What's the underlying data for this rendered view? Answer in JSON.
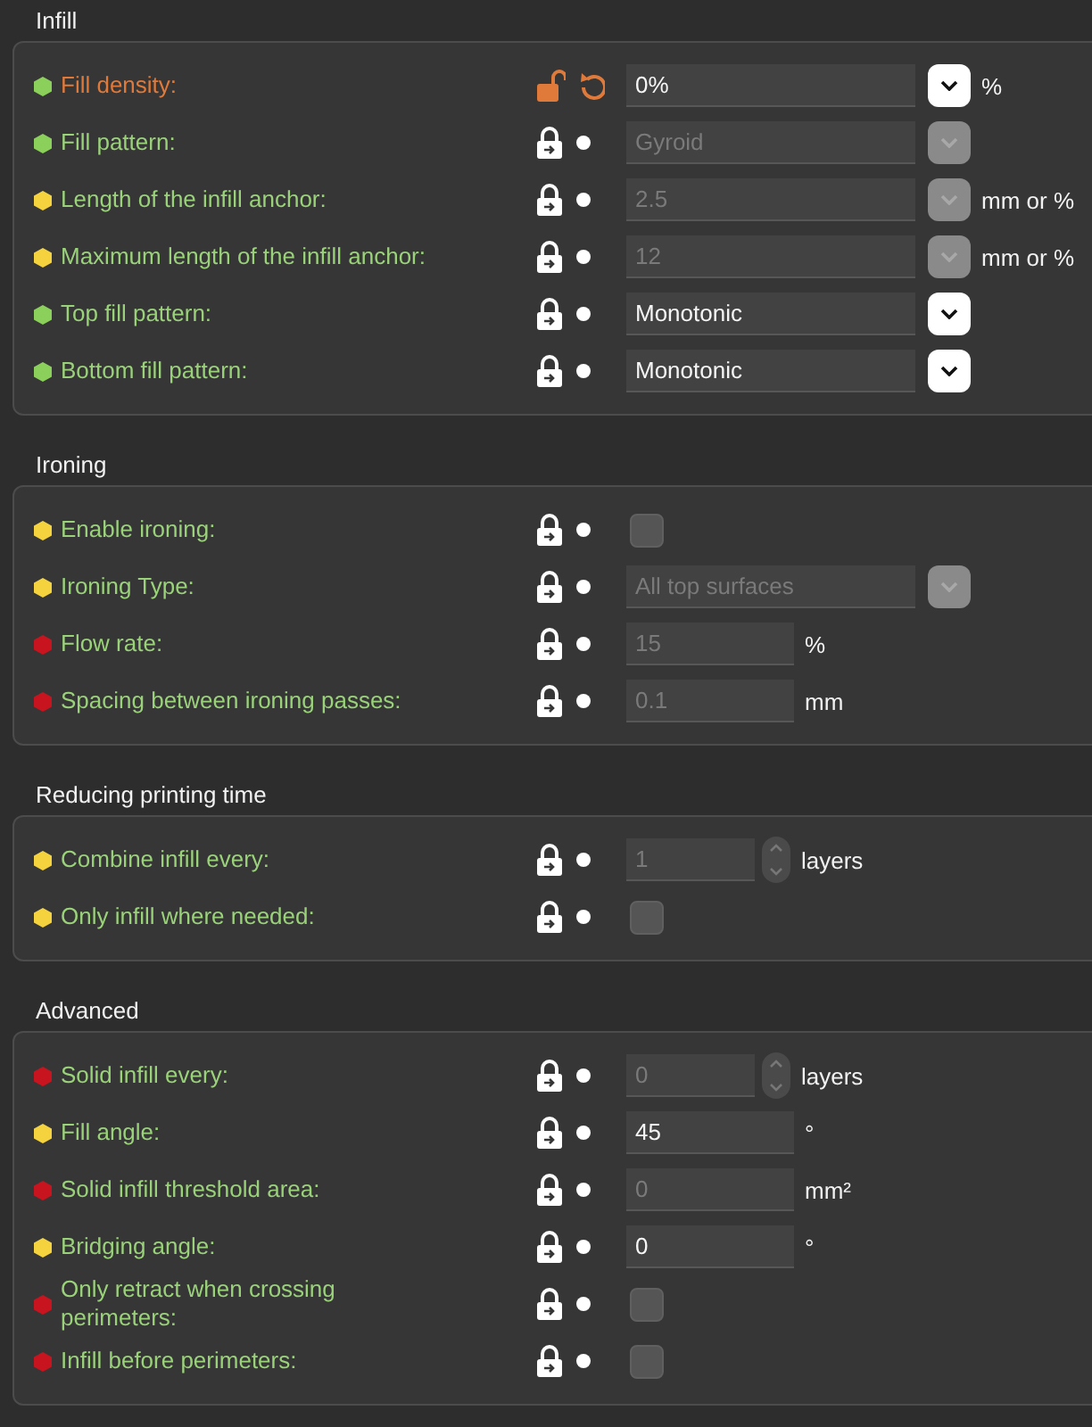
{
  "sections": [
    {
      "title": "Infill",
      "rows": [
        {
          "label": "Fill density:",
          "color": "#8bd05a",
          "modified": true,
          "kind": "combo",
          "value": "0%",
          "disabled": false,
          "unit": "%"
        },
        {
          "label": "Fill pattern:",
          "color": "#8bd05a",
          "modified": false,
          "kind": "combo",
          "value": "Gyroid",
          "disabled": true
        },
        {
          "label": "Length of the infill anchor:",
          "color": "#f5d33f",
          "modified": false,
          "kind": "combo",
          "value": "2.5",
          "disabled": true,
          "unit": "mm or %"
        },
        {
          "label": "Maximum length of the infill anchor:",
          "color": "#f5d33f",
          "modified": false,
          "kind": "combo",
          "value": "12",
          "disabled": true,
          "unit": "mm or %"
        },
        {
          "label": "Top fill pattern:",
          "color": "#8bd05a",
          "modified": false,
          "kind": "combo",
          "value": "Monotonic",
          "disabled": false
        },
        {
          "label": "Bottom fill pattern:",
          "color": "#8bd05a",
          "modified": false,
          "kind": "combo",
          "value": "Monotonic",
          "disabled": false
        }
      ]
    },
    {
      "title": "Ironing",
      "rows": [
        {
          "label": "Enable ironing:",
          "color": "#f5d33f",
          "modified": false,
          "kind": "checkbox",
          "checked": false
        },
        {
          "label": "Ironing Type:",
          "color": "#f5d33f",
          "modified": false,
          "kind": "combo",
          "value": "All top surfaces",
          "disabled": true
        },
        {
          "label": "Flow rate:",
          "color": "#c8141e",
          "modified": false,
          "kind": "text",
          "value": "15",
          "disabled": true,
          "unit": "%"
        },
        {
          "label": "Spacing between ironing passes:",
          "color": "#c8141e",
          "modified": false,
          "kind": "text",
          "value": "0.1",
          "disabled": true,
          "unit": "mm"
        }
      ]
    },
    {
      "title": "Reducing printing time",
      "rows": [
        {
          "label": "Combine infill every:",
          "color": "#f5d33f",
          "modified": false,
          "kind": "spin",
          "value": "1",
          "disabled": true,
          "unit": "layers"
        },
        {
          "label": "Only infill where needed:",
          "color": "#f5d33f",
          "modified": false,
          "kind": "checkbox",
          "checked": false
        }
      ]
    },
    {
      "title": "Advanced",
      "rows": [
        {
          "label": "Solid infill every:",
          "color": "#c8141e",
          "modified": false,
          "kind": "spin",
          "value": "0",
          "disabled": true,
          "unit": "layers"
        },
        {
          "label": "Fill angle:",
          "color": "#f5d33f",
          "modified": false,
          "kind": "text",
          "value": "45",
          "disabled": false,
          "unit": "°"
        },
        {
          "label": "Solid infill threshold area:",
          "color": "#c8141e",
          "modified": false,
          "kind": "text",
          "value": "0",
          "disabled": true,
          "unit": "mm²"
        },
        {
          "label": "Bridging angle:",
          "color": "#f5d33f",
          "modified": false,
          "kind": "text",
          "value": "0",
          "disabled": false,
          "unit": "°"
        },
        {
          "label": "Only retract when crossing\nperimeters:",
          "color": "#c8141e",
          "modified": false,
          "kind": "checkbox",
          "checked": false
        },
        {
          "label": "Infill before perimeters:",
          "color": "#c8141e",
          "modified": false,
          "kind": "checkbox",
          "checked": false
        }
      ]
    }
  ]
}
